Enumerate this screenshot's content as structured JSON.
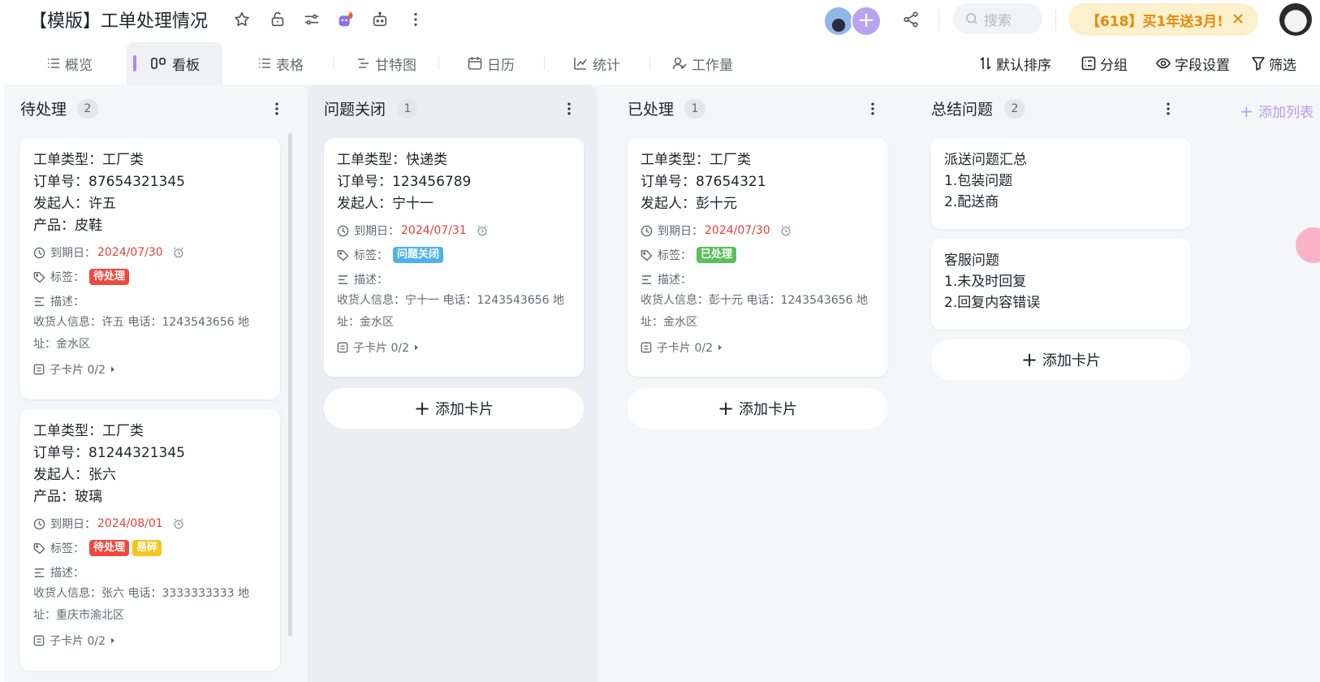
{
  "header": {
    "title": "【模版】工单处理情况",
    "search_placeholder": "搜索",
    "promo_text": "【618】买1年送3月!"
  },
  "tabs": [
    {
      "label": "概览",
      "icon": "list-icon"
    },
    {
      "label": "看板",
      "icon": "kanban-icon",
      "active": true
    },
    {
      "label": "表格",
      "icon": "table-icon"
    },
    {
      "label": "甘特图",
      "icon": "gantt-icon"
    },
    {
      "label": "日历",
      "icon": "calendar-icon"
    },
    {
      "label": "统计",
      "icon": "chart-icon"
    },
    {
      "label": "工作量",
      "icon": "workload-icon"
    }
  ],
  "toolbar": {
    "sort": "默认排序",
    "group": "分组",
    "fields": "字段设置",
    "filter": "筛选"
  },
  "labels": {
    "due": "到期日：",
    "tags": "标签：",
    "desc": "描述：",
    "subcard": "子卡片 0/2",
    "add_card": "添加卡片",
    "add_list": "添加列表"
  },
  "colors": {
    "accent": "#a58bf4",
    "tag_pending": "#f0483e",
    "tag_closed": "#4fb1ea",
    "tag_done": "#5ac05a",
    "tag_fragile": "#f7c51e",
    "due_date": "#e23f3f"
  },
  "columns": [
    {
      "title": "待处理",
      "count": "2",
      "cards": [
        {
          "lines": [
            "工单类型：工厂类",
            "订单号：87654321345",
            "发起人：许五",
            "产品：皮鞋"
          ],
          "due": "2024/07/30",
          "tags": [
            "待处理"
          ],
          "desc1": "收货人信息：许五 电话：1243543656 地",
          "desc2": "址：金水区"
        },
        {
          "lines": [
            "工单类型：工厂类",
            "订单号：81244321345",
            "发起人：张六",
            "产品：玻璃"
          ],
          "due": "2024/08/01",
          "tags": [
            "待处理",
            "易碎"
          ],
          "desc1": "收货人信息：张六 电话：3333333333 地",
          "desc2": "址：重庆市渝北区"
        }
      ]
    },
    {
      "title": "问题关闭",
      "count": "1",
      "cards": [
        {
          "lines": [
            "工单类型：快递类",
            "订单号：123456789",
            "发起人：宁十一"
          ],
          "due": "2024/07/31",
          "tags": [
            "问题关闭"
          ],
          "desc1": "收货人信息：宁十一 电话：1243543656 地",
          "desc2": "址：金水区"
        }
      ]
    },
    {
      "title": "已处理",
      "count": "1",
      "cards": [
        {
          "lines": [
            "工单类型：工厂类",
            "订单号：87654321",
            "发起人：彭十元"
          ],
          "due": "2024/07/30",
          "tags": [
            "已处理"
          ],
          "desc1": "收货人信息：彭十元 电话：1243543656 地",
          "desc2": "址：金水区"
        }
      ]
    },
    {
      "title": "总结问题",
      "count": "2",
      "cards": [
        {
          "lines": [
            "派送问题汇总",
            "1.包装问题",
            "2.配送商"
          ]
        },
        {
          "lines": [
            "客服问题",
            "1.未及时回复",
            "2.回复内容错误"
          ]
        }
      ]
    }
  ]
}
